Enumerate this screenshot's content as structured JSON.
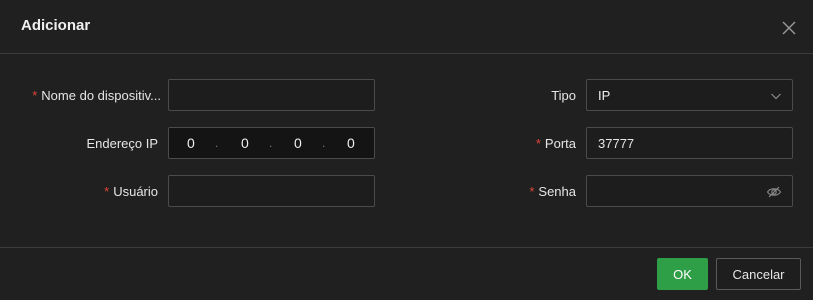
{
  "dialog": {
    "title": "Adicionar",
    "close_icon": "close-icon"
  },
  "form": {
    "required_mark": "*",
    "device_name": {
      "label": "Nome do dispositiv...",
      "value": ""
    },
    "ip_address": {
      "label": "Endereço IP",
      "segments": [
        "0",
        "0",
        "0",
        "0"
      ],
      "separator": "."
    },
    "user": {
      "label": "Usuário",
      "value": ""
    },
    "type": {
      "label": "Tipo",
      "value": "IP",
      "icon": "chevron-down-icon"
    },
    "port": {
      "label": "Porta",
      "value": "37777"
    },
    "password": {
      "label": "Senha",
      "value": "",
      "icon": "eye-off-icon"
    }
  },
  "footer": {
    "ok_label": "OK",
    "cancel_label": "Cancelar"
  },
  "colors": {
    "background": "#202020",
    "required": "#e0453a",
    "primary_button": "#2e9e47"
  }
}
